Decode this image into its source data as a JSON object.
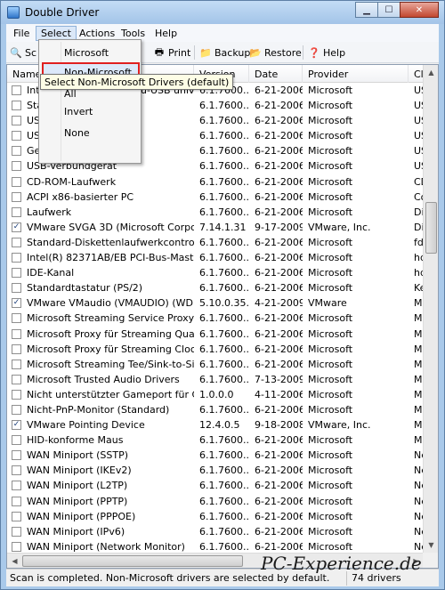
{
  "window": {
    "title": "Double Driver",
    "minimize": "▁",
    "maximize": "☐",
    "close": "✕"
  },
  "menu": [
    "File",
    "Select",
    "Actions",
    "Tools",
    "Help"
  ],
  "toolbar": {
    "scan": "Sc",
    "save": "ve",
    "print": "Print",
    "backup": "Backup",
    "restore": "Restore",
    "help": "Help"
  },
  "columns": [
    "Name",
    "Version",
    "Date",
    "Provider",
    "Cl"
  ],
  "rows": [
    {
      "checked": false,
      "name": "Int",
      "name_tail": "u-USB unive...",
      "version": "6.1.7600....",
      "date": "6-21-2006",
      "provider": "Microsoft",
      "cl": "USI"
    },
    {
      "checked": false,
      "name": "Sta",
      "name_tail": "",
      "version": "6.1.7600....",
      "date": "6-21-2006",
      "provider": "Microsoft",
      "cl": "USI"
    },
    {
      "checked": false,
      "name": "US",
      "name_tail": "",
      "version": "6.1.7600....",
      "date": "6-21-2006",
      "provider": "Microsoft",
      "cl": "USI"
    },
    {
      "checked": false,
      "name": "US",
      "name_tail": "",
      "version": "6.1.7600....",
      "date": "6-21-2006",
      "provider": "Microsoft",
      "cl": "USI"
    },
    {
      "checked": false,
      "name": "Generic USB Hub",
      "name_tail": "",
      "version": "6.1.7600....",
      "date": "6-21-2006",
      "provider": "Microsoft",
      "cl": "USI"
    },
    {
      "checked": false,
      "name": "USB-Verbundgerät",
      "name_tail": "",
      "version": "6.1.7600....",
      "date": "6-21-2006",
      "provider": "Microsoft",
      "cl": "USI"
    },
    {
      "checked": false,
      "name": "CD-ROM-Laufwerk",
      "name_tail": "",
      "version": "6.1.7600....",
      "date": "6-21-2006",
      "provider": "Microsoft",
      "cl": "CD"
    },
    {
      "checked": false,
      "name": "ACPI x86-basierter PC",
      "name_tail": "",
      "version": "6.1.7600....",
      "date": "6-21-2006",
      "provider": "Microsoft",
      "cl": "Co"
    },
    {
      "checked": false,
      "name": "Laufwerk",
      "name_tail": "",
      "version": "6.1.7600....",
      "date": "6-21-2006",
      "provider": "Microsoft",
      "cl": "Dis"
    },
    {
      "checked": true,
      "name": "VMware SVGA 3D (Microsoft Corporat...",
      "name_tail": "",
      "version": "7.14.1.31",
      "date": "9-17-2009",
      "provider": "VMware, Inc.",
      "cl": "Dis"
    },
    {
      "checked": false,
      "name": "Standard-Diskettenlaufwerkcontroller",
      "name_tail": "",
      "version": "6.1.7600....",
      "date": "6-21-2006",
      "provider": "Microsoft",
      "cl": "fdc"
    },
    {
      "checked": false,
      "name": "Intel(R) 82371AB/EB PCI-Bus-Master-I...",
      "name_tail": "",
      "version": "6.1.7600....",
      "date": "6-21-2006",
      "provider": "Microsoft",
      "cl": "hd"
    },
    {
      "checked": false,
      "name": "IDE-Kanal",
      "name_tail": "",
      "version": "6.1.7600....",
      "date": "6-21-2006",
      "provider": "Microsoft",
      "cl": "hd"
    },
    {
      "checked": false,
      "name": "Standardtastatur (PS/2)",
      "name_tail": "",
      "version": "6.1.7600....",
      "date": "6-21-2006",
      "provider": "Microsoft",
      "cl": "Ke"
    },
    {
      "checked": true,
      "name": "VMware VMaudio (VMAUDIO) (WDM)",
      "name_tail": "",
      "version": "5.10.0.35...",
      "date": "4-21-2009",
      "provider": "VMware",
      "cl": "ME"
    },
    {
      "checked": false,
      "name": "Microsoft Streaming Service Proxy",
      "name_tail": "",
      "version": "6.1.7600....",
      "date": "6-21-2006",
      "provider": "Microsoft",
      "cl": "ME"
    },
    {
      "checked": false,
      "name": "Microsoft Proxy für Streaming Quality...",
      "name_tail": "",
      "version": "6.1.7600....",
      "date": "6-21-2006",
      "provider": "Microsoft",
      "cl": "ME"
    },
    {
      "checked": false,
      "name": "Microsoft Proxy für Streaming Clock",
      "name_tail": "",
      "version": "6.1.7600....",
      "date": "6-21-2006",
      "provider": "Microsoft",
      "cl": "ME"
    },
    {
      "checked": false,
      "name": "Microsoft Streaming Tee/Sink-to-Sink...",
      "name_tail": "",
      "version": "6.1.7600....",
      "date": "6-21-2006",
      "provider": "Microsoft",
      "cl": "ME"
    },
    {
      "checked": false,
      "name": "Microsoft Trusted Audio Drivers",
      "name_tail": "",
      "version": "6.1.7600....",
      "date": "7-13-2009",
      "provider": "Microsoft",
      "cl": "ME"
    },
    {
      "checked": false,
      "name": "Nicht unterstützter Gameport für Crea...",
      "name_tail": "",
      "version": "1.0.0.0",
      "date": "4-11-2006",
      "provider": "Microsoft",
      "cl": "ME"
    },
    {
      "checked": false,
      "name": "Nicht-PnP-Monitor (Standard)",
      "name_tail": "",
      "version": "6.1.7600....",
      "date": "6-21-2006",
      "provider": "Microsoft",
      "cl": "Mo"
    },
    {
      "checked": true,
      "name": "VMware Pointing Device",
      "name_tail": "",
      "version": "12.4.0.5",
      "date": "9-18-2008",
      "provider": "VMware, Inc.",
      "cl": "Mo"
    },
    {
      "checked": false,
      "name": "HID-konforme Maus",
      "name_tail": "",
      "version": "6.1.7600....",
      "date": "6-21-2006",
      "provider": "Microsoft",
      "cl": "Mo"
    },
    {
      "checked": false,
      "name": "WAN Miniport (SSTP)",
      "name_tail": "",
      "version": "6.1.7600....",
      "date": "6-21-2006",
      "provider": "Microsoft",
      "cl": "Ne"
    },
    {
      "checked": false,
      "name": "WAN Miniport (IKEv2)",
      "name_tail": "",
      "version": "6.1.7600....",
      "date": "6-21-2006",
      "provider": "Microsoft",
      "cl": "Ne"
    },
    {
      "checked": false,
      "name": "WAN Miniport (L2TP)",
      "name_tail": "",
      "version": "6.1.7600....",
      "date": "6-21-2006",
      "provider": "Microsoft",
      "cl": "Ne"
    },
    {
      "checked": false,
      "name": "WAN Miniport (PPTP)",
      "name_tail": "",
      "version": "6.1.7600....",
      "date": "6-21-2006",
      "provider": "Microsoft",
      "cl": "Ne"
    },
    {
      "checked": false,
      "name": "WAN Miniport (PPPOE)",
      "name_tail": "",
      "version": "6.1.7600....",
      "date": "6-21-2006",
      "provider": "Microsoft",
      "cl": "Ne"
    },
    {
      "checked": false,
      "name": "WAN Miniport (IPv6)",
      "name_tail": "",
      "version": "6.1.7600....",
      "date": "6-21-2006",
      "provider": "Microsoft",
      "cl": "Ne"
    },
    {
      "checked": false,
      "name": "WAN Miniport (Network Monitor)",
      "name_tail": "",
      "version": "6.1.7600....",
      "date": "6-21-2006",
      "provider": "Microsoft",
      "cl": "Ne"
    }
  ],
  "select_menu": [
    "Microsoft",
    "Non-Microsoft",
    "All",
    "Invert",
    "None"
  ],
  "tooltip": "Select Non-Microsoft Drivers (default)",
  "status": {
    "text": "Scan is completed. Non-Microsoft drivers are selected by default.",
    "count": "74 drivers"
  },
  "watermark": "PC-Experience.de",
  "colors": {
    "highlight_border": "#e02020",
    "title_bar": "#a9c9ea"
  }
}
